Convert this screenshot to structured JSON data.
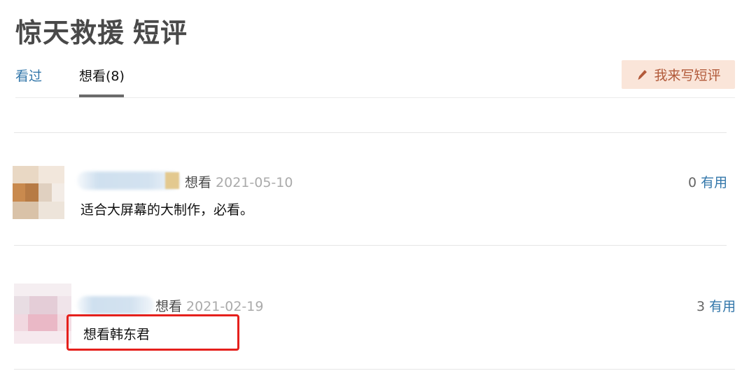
{
  "page": {
    "title_main": "惊天救援",
    "title_sub": "短评"
  },
  "tabs": [
    {
      "label": "看过"
    },
    {
      "label": "想看(8)"
    }
  ],
  "write_button": {
    "label": "我来写短评",
    "icon": "pencil-icon"
  },
  "comments": [
    {
      "status": "想看",
      "date": "2021-05-10",
      "text": "适合大屏幕的大制作，必看。",
      "useful_count": "0",
      "useful_label": "有用"
    },
    {
      "status": "想看",
      "date": "2021-02-19",
      "text": "想看韩东君",
      "useful_count": "3",
      "useful_label": "有用"
    }
  ],
  "colors": {
    "link": "#3377aa",
    "button_bg": "#fae5d9",
    "button_text": "#b25a3a",
    "highlight": "#e5201c"
  }
}
